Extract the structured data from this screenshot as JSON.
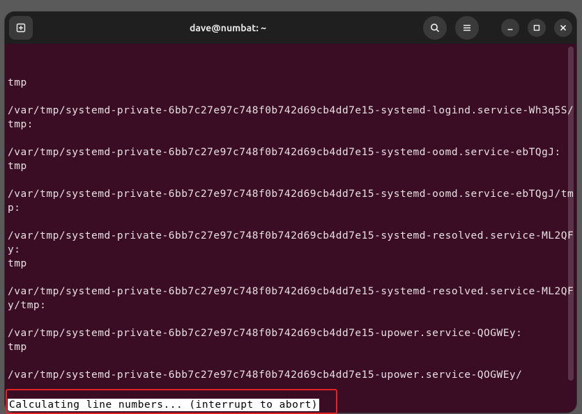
{
  "titlebar": {
    "title": "dave@numbat: ~"
  },
  "terminal": {
    "lines": [
      "tmp",
      "",
      "/var/tmp/systemd-private-6bb7c27e97c748f0b742d69cb4dd7e15-systemd-logind.service-Wh3q5S/tmp:",
      "",
      "/var/tmp/systemd-private-6bb7c27e97c748f0b742d69cb4dd7e15-systemd-oomd.service-ebTQgJ:",
      "tmp",
      "",
      "/var/tmp/systemd-private-6bb7c27e97c748f0b742d69cb4dd7e15-systemd-oomd.service-ebTQgJ/tmp:",
      "",
      "/var/tmp/systemd-private-6bb7c27e97c748f0b742d69cb4dd7e15-systemd-resolved.service-ML2QFy:",
      "tmp",
      "",
      "/var/tmp/systemd-private-6bb7c27e97c748f0b742d69cb4dd7e15-systemd-resolved.service-ML2QFy/tmp:",
      "",
      "/var/tmp/systemd-private-6bb7c27e97c748f0b742d69cb4dd7e15-upower.service-QOGWEy:",
      "tmp",
      "",
      "/var/tmp/systemd-private-6bb7c27e97c748f0b742d69cb4dd7e15-upower.service-QOGWEy/"
    ],
    "status": "Calculating line numbers... (interrupt to abort)"
  }
}
